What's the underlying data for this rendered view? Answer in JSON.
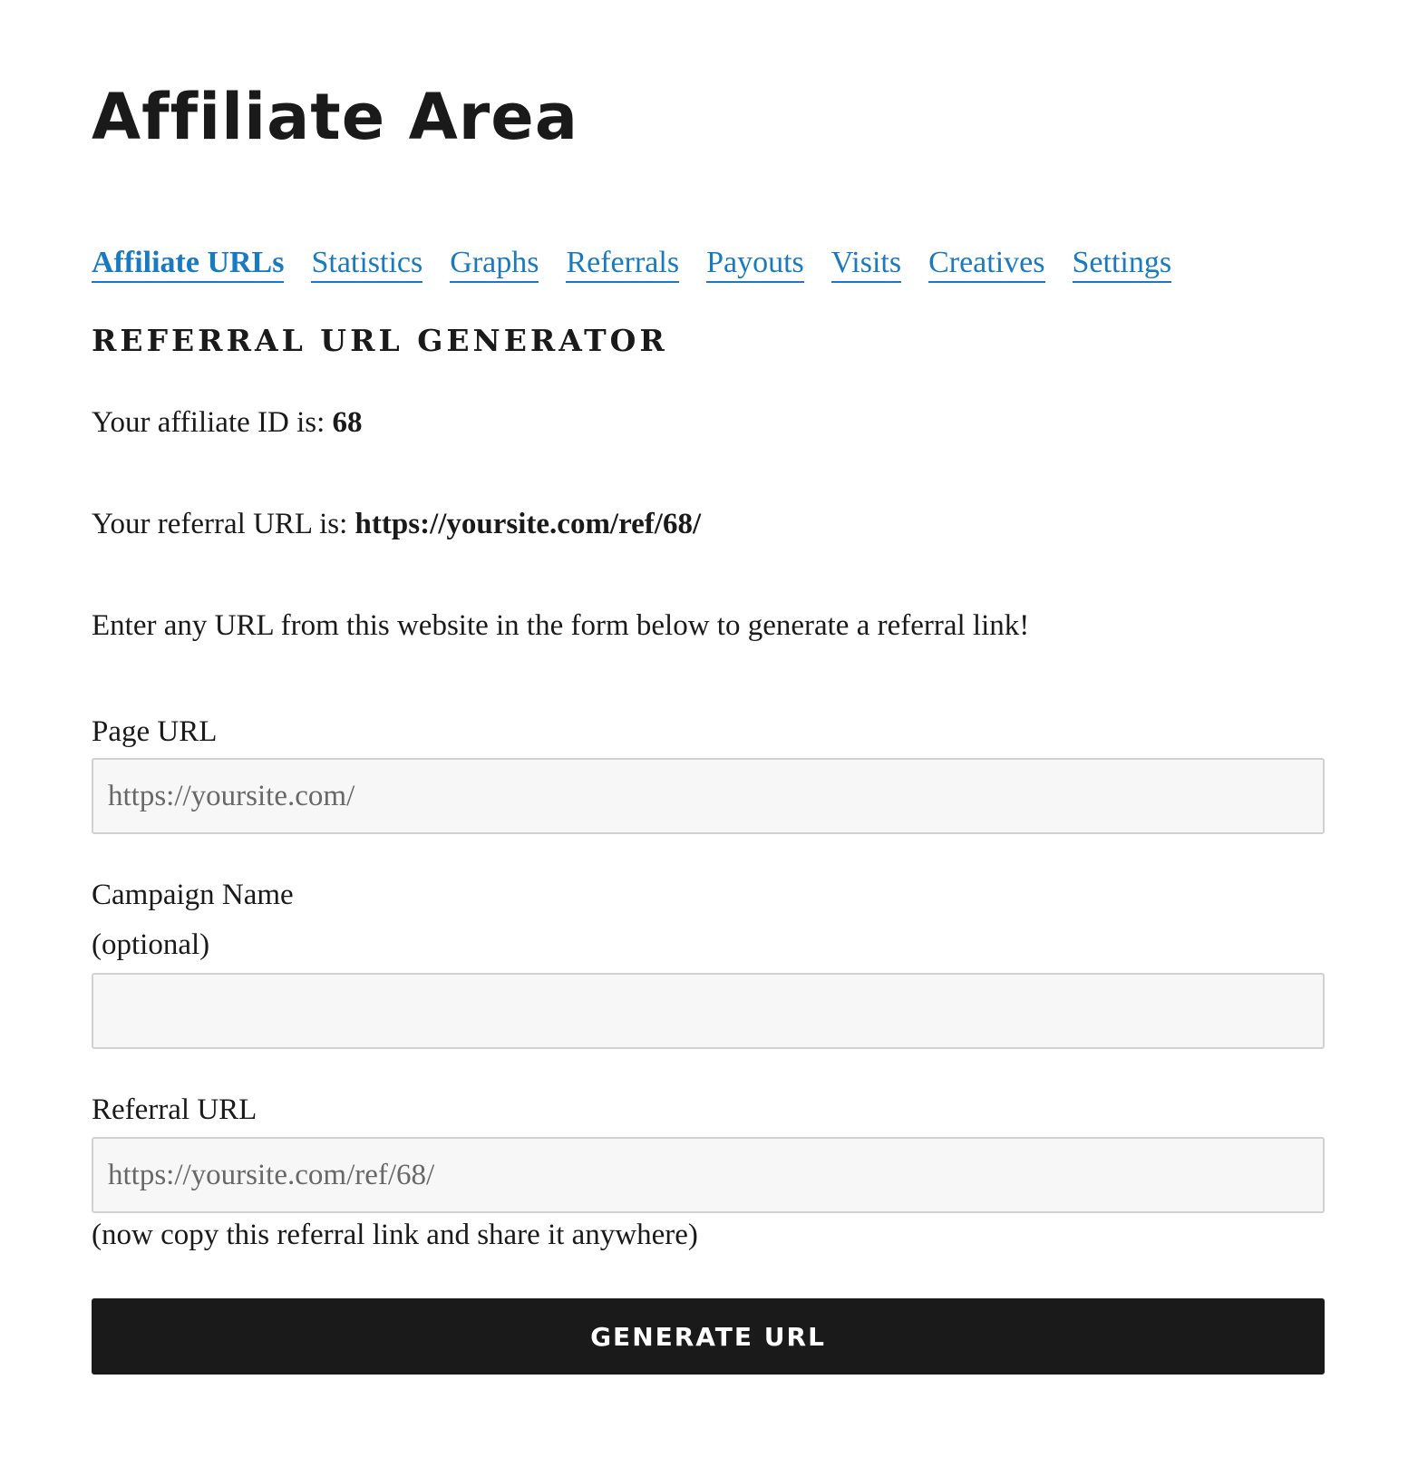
{
  "page": {
    "title": "Affiliate Area"
  },
  "tabs": [
    {
      "label": "Affiliate URLs",
      "active": true
    },
    {
      "label": "Statistics",
      "active": false
    },
    {
      "label": "Graphs",
      "active": false
    },
    {
      "label": "Referrals",
      "active": false
    },
    {
      "label": "Payouts",
      "active": false
    },
    {
      "label": "Visits",
      "active": false
    },
    {
      "label": "Creatives",
      "active": false
    },
    {
      "label": "Settings",
      "active": false
    }
  ],
  "generator": {
    "heading": "REFERRAL URL GENERATOR",
    "affiliate_id_prefix": "Your affiliate ID is: ",
    "affiliate_id": "68",
    "referral_url_prefix": "Your referral URL is: ",
    "referral_url": "https://yoursite.com/ref/68/",
    "instructions": "Enter any URL from this website in the form below to generate a referral link!"
  },
  "form": {
    "page_url": {
      "label": "Page URL",
      "value": "https://yoursite.com/"
    },
    "campaign_name": {
      "label_line1": "Campaign Name",
      "label_line2": "(optional)",
      "value": ""
    },
    "referral_url": {
      "label": "Referral URL",
      "value": "https://yoursite.com/ref/68/",
      "hint": "(now copy this referral link and share it anywhere)"
    },
    "submit_label": "GENERATE URL"
  },
  "colors": {
    "link": "#1a7ac0",
    "text": "#1a1a1a",
    "button_bg": "#1a1a1a",
    "input_bg": "#f7f7f7"
  }
}
